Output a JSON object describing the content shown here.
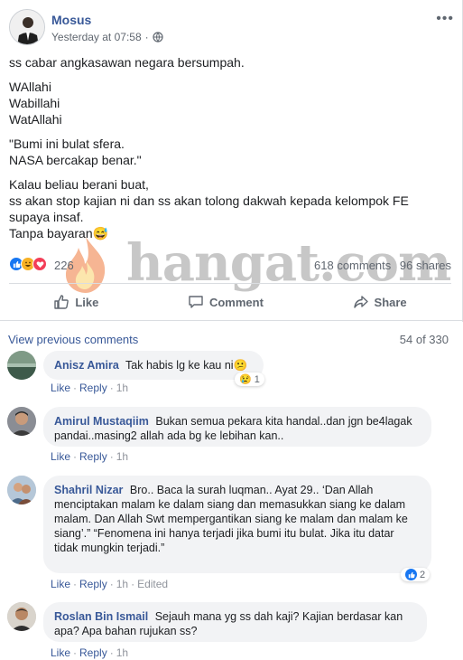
{
  "colors": {
    "link": "#385898",
    "text": "#1c1e21",
    "muted": "#606770",
    "like_blue": "#1877f2",
    "love_red": "#f33e58",
    "haha_yellow": "#f7b125"
  },
  "post": {
    "author": "Mosus",
    "timestamp": "Yesterday at 07:58",
    "privacy_icon": "globe-icon",
    "more_icon": "more-options-icon",
    "more_glyph": "•••",
    "lines": [
      "ss cabar angkasawan negara bersumpah.",
      "WAllahi",
      "Wabillahi",
      "WatAllahi",
      "\"Bumi ini bulat sfera.",
      "NASA bercakap benar.\"",
      "Kalau beliau berani buat,",
      "ss akan stop kajian ni dan ss akan tolong dakwah kepada kelompok FE supaya insaf.",
      "Tanpa bayaran😅"
    ],
    "reactions": {
      "icons": [
        "like-reaction-icon",
        "haha-reaction-icon",
        "love-reaction-icon"
      ],
      "count": "226"
    },
    "comments_count": "618 comments",
    "shares_count": "96 shares",
    "actions": {
      "like": "Like",
      "comment": "Comment",
      "share": "Share"
    }
  },
  "watermark": {
    "text": "hangat.com"
  },
  "comments_section": {
    "view_previous": "View previous comments",
    "page_count": "54 of 330",
    "comments": [
      {
        "name": "Anisz Amira",
        "text": "Tak habis lg ke kau ni😕",
        "like": "Like",
        "reply": "Reply",
        "time": "1h",
        "reaction_emoji": "😢",
        "reaction_count": "1"
      },
      {
        "name": "Amirul Mustaqiim",
        "text": "Bukan semua pekara kita handal..dan jgn be4lagak pandai..masing2 allah ada bg ke lebihan kan..",
        "like": "Like",
        "reply": "Reply",
        "time": "1h"
      },
      {
        "name": "Shahril Nizar",
        "text": "Bro.. Baca la surah luqman.. Ayat 29.. ‘Dan Allah menciptakan malam ke dalam siang dan memasukkan siang ke dalam malam. Dan Allah Swt mempergantikan siang ke malam dan malam ke siang’.” “Fenomena ini hanya terjadi jika bumi itu bulat. Jika itu datar tidak mungkin terjadi.”",
        "like": "Like",
        "reply": "Reply",
        "time": "1h",
        "edited": "Edited",
        "reaction_count": "2"
      },
      {
        "name": "Roslan Bin Ismail",
        "text": "Sejauh mana yg ss dah kaji? Kajian berdasar kan apa? Apa bahan rujukan ss?",
        "like": "Like",
        "reply": "Reply",
        "time": "1h"
      }
    ]
  }
}
